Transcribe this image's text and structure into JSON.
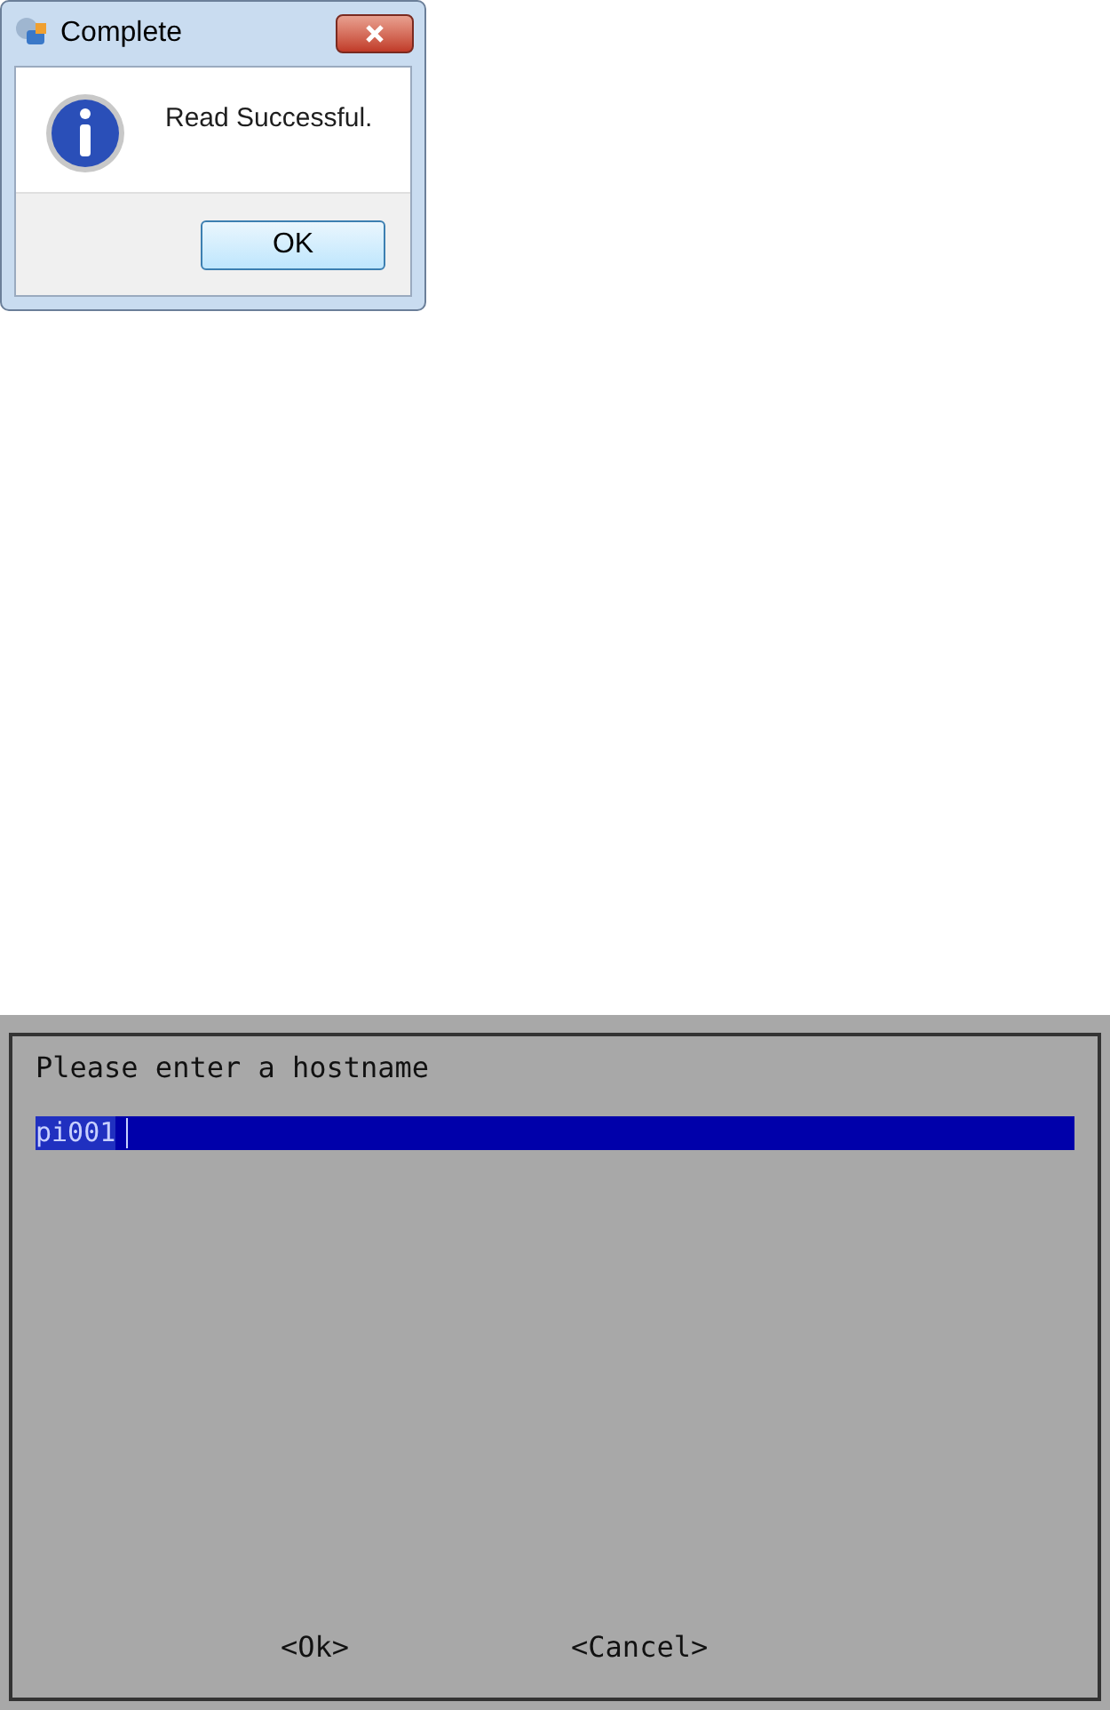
{
  "message_box": {
    "title": "Complete",
    "message": "Read Successful.",
    "button": "OK"
  },
  "hostname_dialog": {
    "prompt": "Please enter a hostname",
    "value": "pi001",
    "buttons": [
      {
        "label": "<Ok>"
      },
      {
        "label": "<Cancel>"
      }
    ]
  }
}
